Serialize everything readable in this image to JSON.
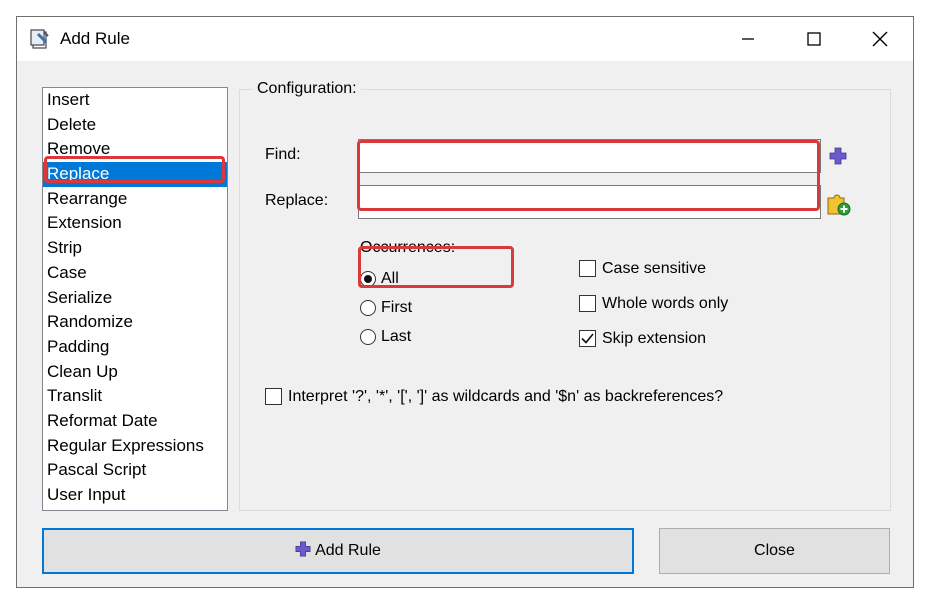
{
  "window": {
    "title": "Add Rule",
    "controls": [
      "minimize-icon",
      "maximize-icon",
      "close-icon"
    ]
  },
  "rules": {
    "items": [
      {
        "label": "Insert"
      },
      {
        "label": "Delete"
      },
      {
        "label": "Remove"
      },
      {
        "label": "Replace",
        "selected": true
      },
      {
        "label": "Rearrange"
      },
      {
        "label": "Extension"
      },
      {
        "label": "Strip"
      },
      {
        "label": "Case"
      },
      {
        "label": "Serialize"
      },
      {
        "label": "Randomize"
      },
      {
        "label": "Padding"
      },
      {
        "label": "Clean Up"
      },
      {
        "label": "Translit"
      },
      {
        "label": "Reformat Date"
      },
      {
        "label": "Regular Expressions"
      },
      {
        "label": "Pascal Script"
      },
      {
        "label": "User Input"
      }
    ]
  },
  "config": {
    "group_label": "Configuration:",
    "find_label": "Find:",
    "find_value": "",
    "replace_label": "Replace:",
    "replace_value": "",
    "find_tool_icon": "add-symbol-icon",
    "replace_tool_icon": "add-puzzle-icon",
    "occurrences": {
      "label": "Occurrences:",
      "options": [
        {
          "label": "All",
          "checked": true
        },
        {
          "label": "First",
          "checked": false
        },
        {
          "label": "Last",
          "checked": false
        }
      ]
    },
    "case_sensitive": {
      "label": "Case sensitive",
      "checked": false
    },
    "whole_words": {
      "label": "Whole words only",
      "checked": false
    },
    "skip_extension": {
      "label": "Skip extension",
      "checked": true
    },
    "wildcards": {
      "label": "Interpret '?', '*', '[', ']' as wildcards and '$n' as backreferences?",
      "checked": false
    }
  },
  "buttons": {
    "add_rule": "Add Rule",
    "close": "Close"
  },
  "colors": {
    "selection": "#0078d7",
    "highlight": "#d9393b",
    "add_icon": "#6a5acd"
  }
}
